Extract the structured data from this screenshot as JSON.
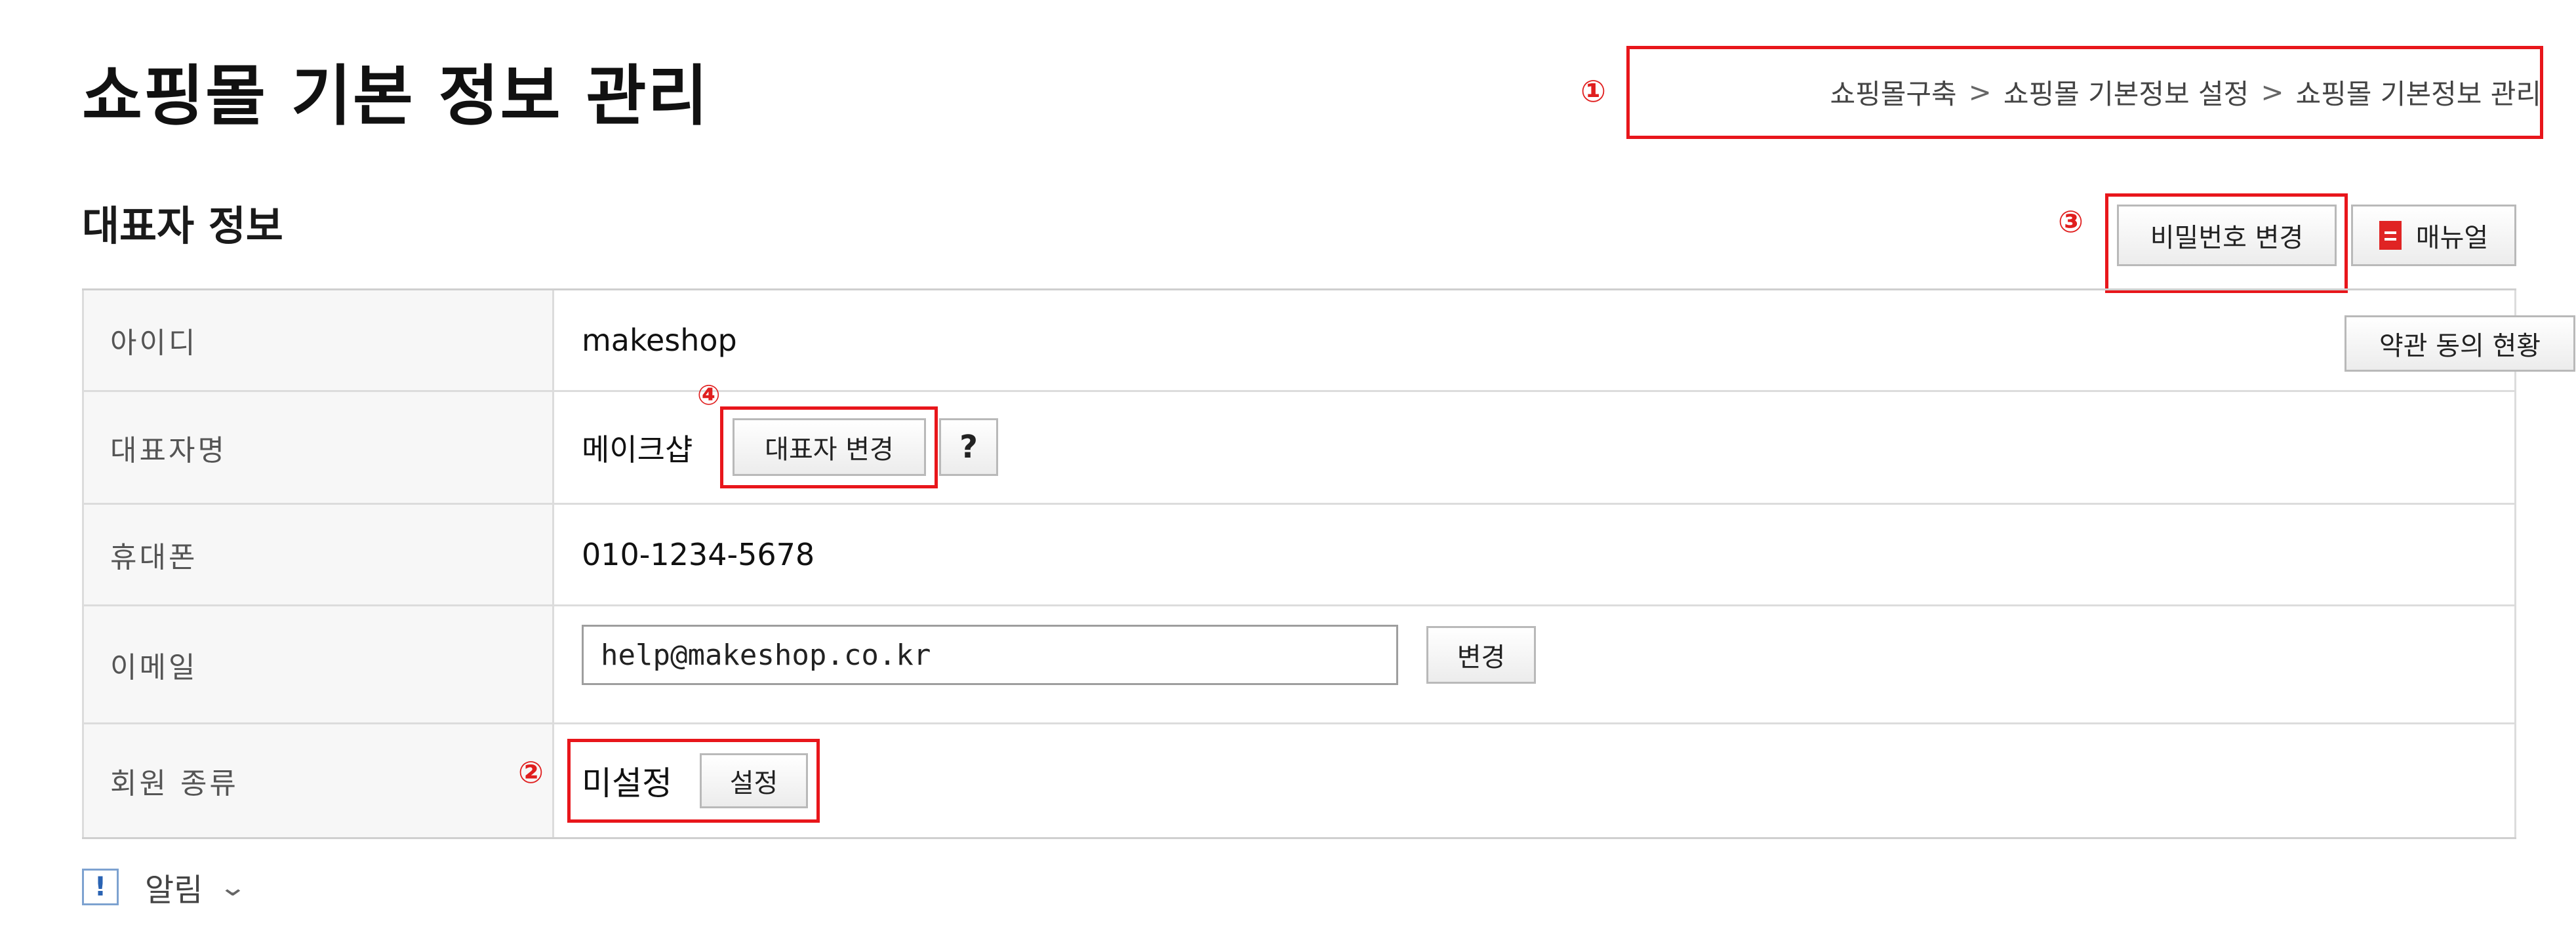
{
  "page_title": "쇼핑몰 기본 정보 관리",
  "breadcrumb": {
    "items": [
      "쇼핑몰구축",
      "쇼핑몰 기본정보 설정",
      "쇼핑몰 기본정보 관리"
    ],
    "separator": ">"
  },
  "markers": [
    "①",
    "②",
    "③",
    "④"
  ],
  "section_title": "대표자 정보",
  "header_buttons": {
    "password_change": "비밀번호 변경",
    "manual": "매뉴얼"
  },
  "rows": {
    "id": {
      "label": "아이디",
      "value": "makeshop",
      "button": "약관 동의 현황"
    },
    "representative": {
      "label": "대표자명",
      "value": "메이크샵",
      "button": "대표자 변경",
      "help": "?"
    },
    "phone": {
      "label": "휴대폰",
      "value": "010-1234-5678"
    },
    "email": {
      "label": "이메일",
      "value": "help@makeshop.co.kr",
      "button": "변경"
    },
    "member_type": {
      "label": "회원 종류",
      "value": "미설정",
      "button": "설정"
    }
  },
  "notice": {
    "icon": "!",
    "label": "알림"
  },
  "colors": {
    "highlight": "#e8161b",
    "manual_icon": "#e02424",
    "notice_icon": "#2a63b3"
  }
}
